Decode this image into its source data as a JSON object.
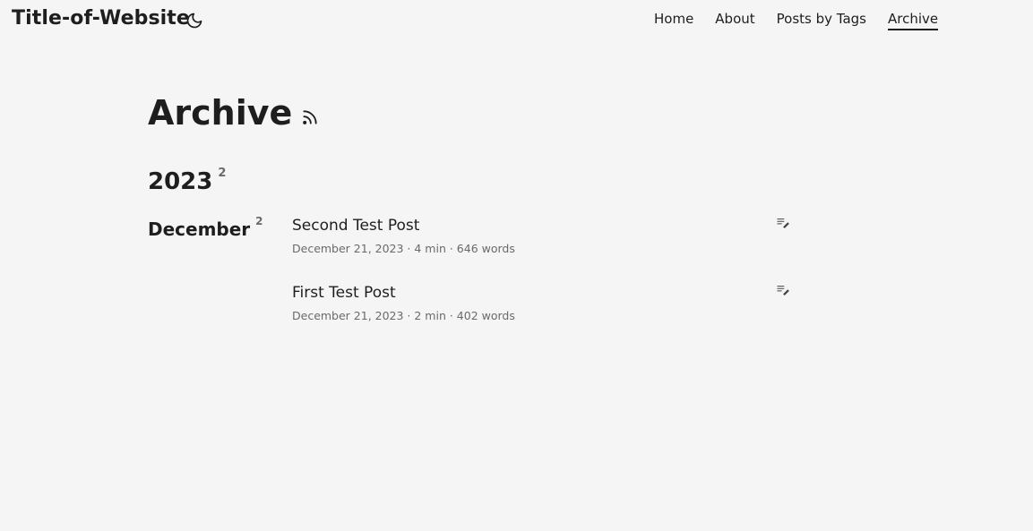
{
  "header": {
    "site_title": "Title-of-Website",
    "theme_toggle_icon": "moon-icon",
    "nav": [
      {
        "label": "Home",
        "active": false
      },
      {
        "label": "About",
        "active": false
      },
      {
        "label": "Posts by Tags",
        "active": false
      },
      {
        "label": "Archive",
        "active": true
      }
    ]
  },
  "main": {
    "title": "Archive",
    "rss_icon": "rss-icon",
    "years": [
      {
        "year": "2023",
        "count": "2",
        "months": [
          {
            "name": "December",
            "count": "2",
            "posts": [
              {
                "title": "Second Test Post",
                "meta": "December 21, 2023 · 4 min · 646 words",
                "icon": "edit-icon"
              },
              {
                "title": "First Test Post",
                "meta": "December 21, 2023 · 2 min · 402 words",
                "icon": "edit-icon"
              }
            ]
          }
        ]
      }
    ]
  }
}
